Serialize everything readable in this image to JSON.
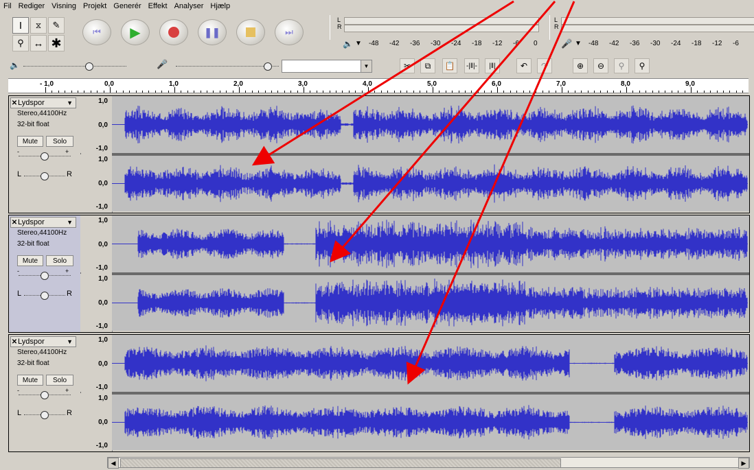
{
  "menu": [
    "Fil",
    "Rediger",
    "Visning",
    "Projekt",
    "Generér",
    "Effekt",
    "Analyser",
    "Hjælp"
  ],
  "meters": {
    "left_label": "L",
    "right_label": "R",
    "play_scale": [
      "-48",
      "-42",
      "-36",
      "-30",
      "-24",
      "-18",
      "-12",
      "-6",
      "0"
    ],
    "rec_scale": [
      "-48",
      "-42",
      "-36",
      "-30",
      "-24",
      "-18",
      "-12",
      "-6"
    ]
  },
  "mixer": {
    "volume_icon": "speaker-icon",
    "mic_icon": "microphone-icon"
  },
  "ruler": {
    "labels": [
      "- 1,0",
      "0,0",
      "1,0",
      "2,0",
      "3,0",
      "4,0",
      "5,0",
      "6,0",
      "7,0",
      "8,0",
      "9,0"
    ]
  },
  "tracks": [
    {
      "name": "Lydspor",
      "rate": "Stereo,44100Hz",
      "format": "32-bit float",
      "mute": "Mute",
      "solo": "Solo",
      "left": "L",
      "right": "R",
      "scale": [
        "1,0",
        "0,0",
        "-1,0",
        "1,0",
        "0,0",
        "-1,0"
      ],
      "selected": false,
      "seed": 3
    },
    {
      "name": "Lydspor",
      "rate": "Stereo,44100Hz",
      "format": "32-bit float",
      "mute": "Mute",
      "solo": "Solo",
      "left": "L",
      "right": "R",
      "scale": [
        "1,0",
        "0,0",
        "-1,0",
        "1,0",
        "0,0",
        "-1,0"
      ],
      "selected": true,
      "seed": 7
    },
    {
      "name": "Lydspor",
      "rate": "Stereo,44100Hz",
      "format": "32-bit float",
      "mute": "Mute",
      "solo": "Solo",
      "left": "L",
      "right": "R",
      "scale": [
        "1,0",
        "0,0",
        "-1,0",
        "1,0",
        "0,0",
        "-1,0"
      ],
      "selected": false,
      "seed": 11
    }
  ],
  "colors": {
    "waveform": "#3232c8",
    "annotation_arrow": "#ee0000",
    "wave_bg": "#bfbfbf"
  }
}
